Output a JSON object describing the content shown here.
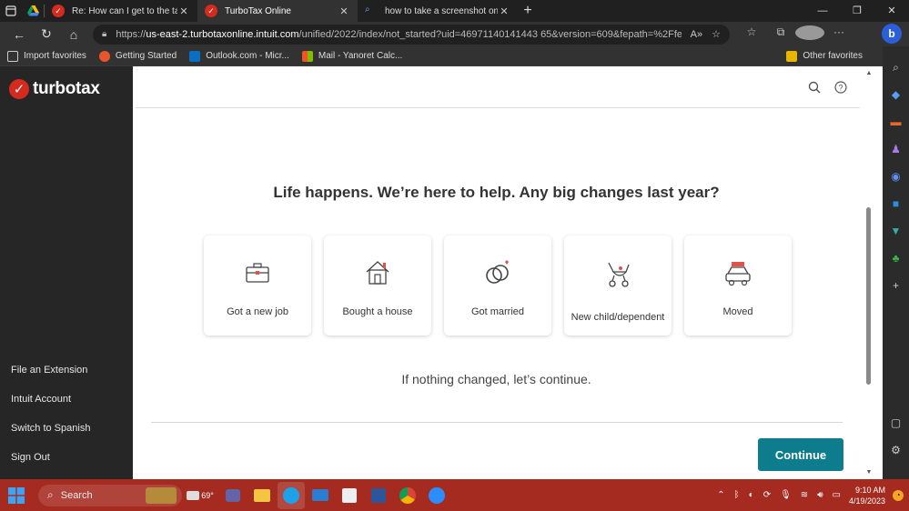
{
  "browser": {
    "tabs": [
      {
        "title": "Re: How can I get to the tax retur",
        "active": false
      },
      {
        "title": "TurboTax Online",
        "active": true
      },
      {
        "title": "how to take a screenshot on win",
        "active": false
      }
    ],
    "url_scheme": "https://",
    "url_host": "us-east-2.turbotaxonline.intuit.com",
    "url_path": "/unified/2022/index/not_started?uid=46971140141443 65&version=609&fepath=%2Ffe...",
    "favorites": [
      {
        "label": "Import favorites"
      },
      {
        "label": "Getting Started"
      },
      {
        "label": "Outlook.com - Micr..."
      },
      {
        "label": "Mail - Yanoret Calc..."
      }
    ],
    "other_favorites": "Other favorites"
  },
  "app": {
    "logo_text": "turbotax",
    "sidebar_links": [
      "File an Extension",
      "Intuit Account",
      "Switch to Spanish",
      "Sign Out"
    ]
  },
  "main": {
    "headline": "Life happens. We’re here to help. Any big changes last year?",
    "cards": [
      {
        "label": "Got a new job",
        "icon": "briefcase-icon"
      },
      {
        "label": "Bought a house",
        "icon": "house-icon"
      },
      {
        "label": "Got married",
        "icon": "rings-icon"
      },
      {
        "label": "New child/dependent",
        "icon": "stroller-icon"
      },
      {
        "label": "Moved",
        "icon": "car-icon"
      }
    ],
    "continue_text": "If nothing changed, let’s continue.",
    "continue_button": "Continue"
  },
  "taskbar": {
    "search_label": "Search",
    "weather": "69°",
    "time": "9:10 AM",
    "date": "4/19/2023"
  },
  "colors": {
    "brand_red": "#d52b1e",
    "continue_teal": "#0d7c8c",
    "taskbar": "#a52a1f"
  }
}
